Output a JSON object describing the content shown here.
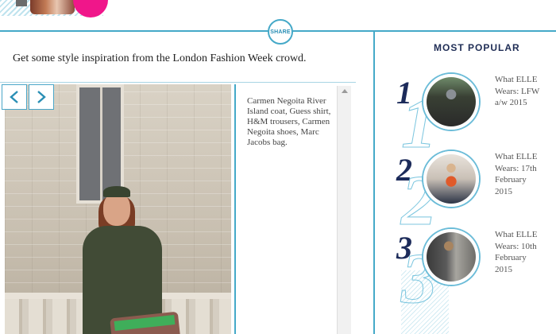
{
  "share": {
    "label": "SHARE"
  },
  "article": {
    "intro": "Get some style inspiration from the London Fashion Week crowd.",
    "caption": "Carmen Negoita River Island coat, Guess shirt, H&M trousers, Carmen Negoita shoes, Marc Jacobs bag."
  },
  "gallery": {
    "prev_icon": "chevron-left-icon",
    "next_icon": "chevron-right-icon"
  },
  "sidebar": {
    "title": "MOST POPULAR",
    "items": [
      {
        "rank": "1",
        "title": "What ELLE Wears: LFW a/w 2015"
      },
      {
        "rank": "2",
        "title": "What ELLE Wears: 17th February 2015"
      },
      {
        "rank": "3",
        "title": "What ELLE Wears: 10th February 2015"
      }
    ]
  },
  "colors": {
    "accent": "#45a9c8",
    "navy": "#1c2b5a",
    "pink": "#f0168a"
  }
}
